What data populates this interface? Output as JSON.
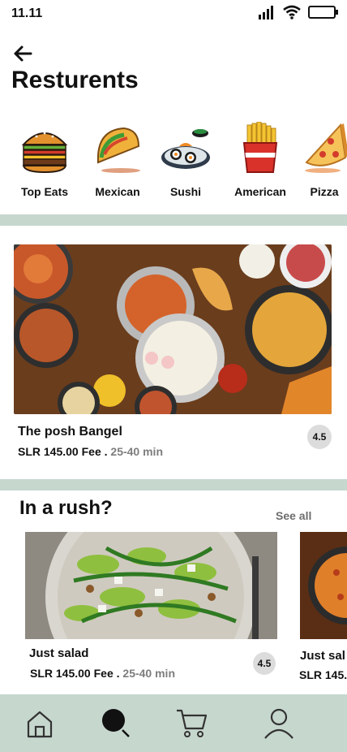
{
  "status": {
    "time": "11.11"
  },
  "header": {
    "title": "Resturents"
  },
  "categories": [
    {
      "label": "Top Eats",
      "icon": "burger-icon"
    },
    {
      "label": "Mexican",
      "icon": "taco-icon"
    },
    {
      "label": "Sushi",
      "icon": "sushi-icon"
    },
    {
      "label": "American",
      "icon": "fries-icon"
    },
    {
      "label": "Pizza",
      "icon": "pizza-icon"
    }
  ],
  "featured": {
    "name": "The posh Bangel",
    "price": "SLR 145.00 Fee .",
    "time": "25-40 min",
    "rating": "4.5"
  },
  "rush": {
    "title": "In a rush?",
    "see_all": "See all",
    "cards": [
      {
        "name": "Just salad",
        "price": "SLR 145.00 Fee .",
        "time": "25-40 min",
        "rating": "4.5"
      },
      {
        "name": "Just sal",
        "price": "SLR 145."
      }
    ]
  },
  "nav": [
    "home-icon",
    "search-icon",
    "cart-icon",
    "profile-icon"
  ],
  "colors": {
    "accent_band": "#c6d7ce",
    "muted": "#7d7d7d"
  }
}
